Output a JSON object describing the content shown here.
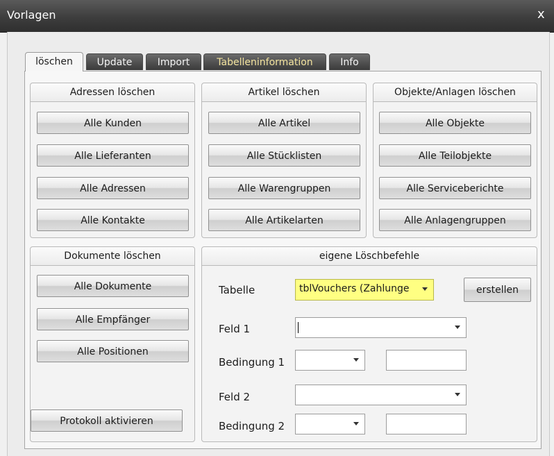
{
  "window": {
    "title": "Vorlagen",
    "close_label": "x"
  },
  "tabs": [
    {
      "label": "löschen",
      "active": true
    },
    {
      "label": "Update"
    },
    {
      "label": "Import"
    },
    {
      "label": "Tabelleninformation"
    },
    {
      "label": "Info"
    }
  ],
  "adressen": {
    "title": "Adressen löschen",
    "buttons": [
      "Alle Kunden",
      "Alle Lieferanten",
      "Alle Adressen",
      "Alle Kontakte"
    ]
  },
  "artikel": {
    "title": "Artikel löschen",
    "buttons": [
      "Alle Artikel",
      "Alle Stücklisten",
      "Alle Warengruppen",
      "Alle Artikelarten"
    ]
  },
  "objekte": {
    "title": "Objekte/Anlagen löschen",
    "buttons": [
      "Alle Objekte",
      "Alle Teilobjekte",
      "Alle Serviceberichte",
      "Alle Anlagengruppen"
    ]
  },
  "dokumente": {
    "title": "Dokumente löschen",
    "buttons": [
      "Alle Dokumente",
      "Alle Empfänger",
      "Alle Positionen"
    ],
    "protokoll_label": "Protokoll aktivieren"
  },
  "eigene": {
    "title": "eigene Löschbefehle",
    "tabelle_label": "Tabelle",
    "tabelle_value": "tblVouchers (Zahlunge",
    "erstellen_label": "erstellen",
    "feld1_label": "Feld 1",
    "feld1_value": "",
    "bedingung1_label": "Bedingung 1",
    "bedingung1_value": "",
    "wert1_value": "",
    "feld2_label": "Feld 2",
    "feld2_value": "",
    "bedingung2_label": "Bedingung 2",
    "bedingung2_value": "",
    "wert2_value": ""
  },
  "colors": {
    "titlebar": "#3d3d3d",
    "tab_dark": "#4a4a4a",
    "tabelle_highlight": "#ffff82"
  }
}
